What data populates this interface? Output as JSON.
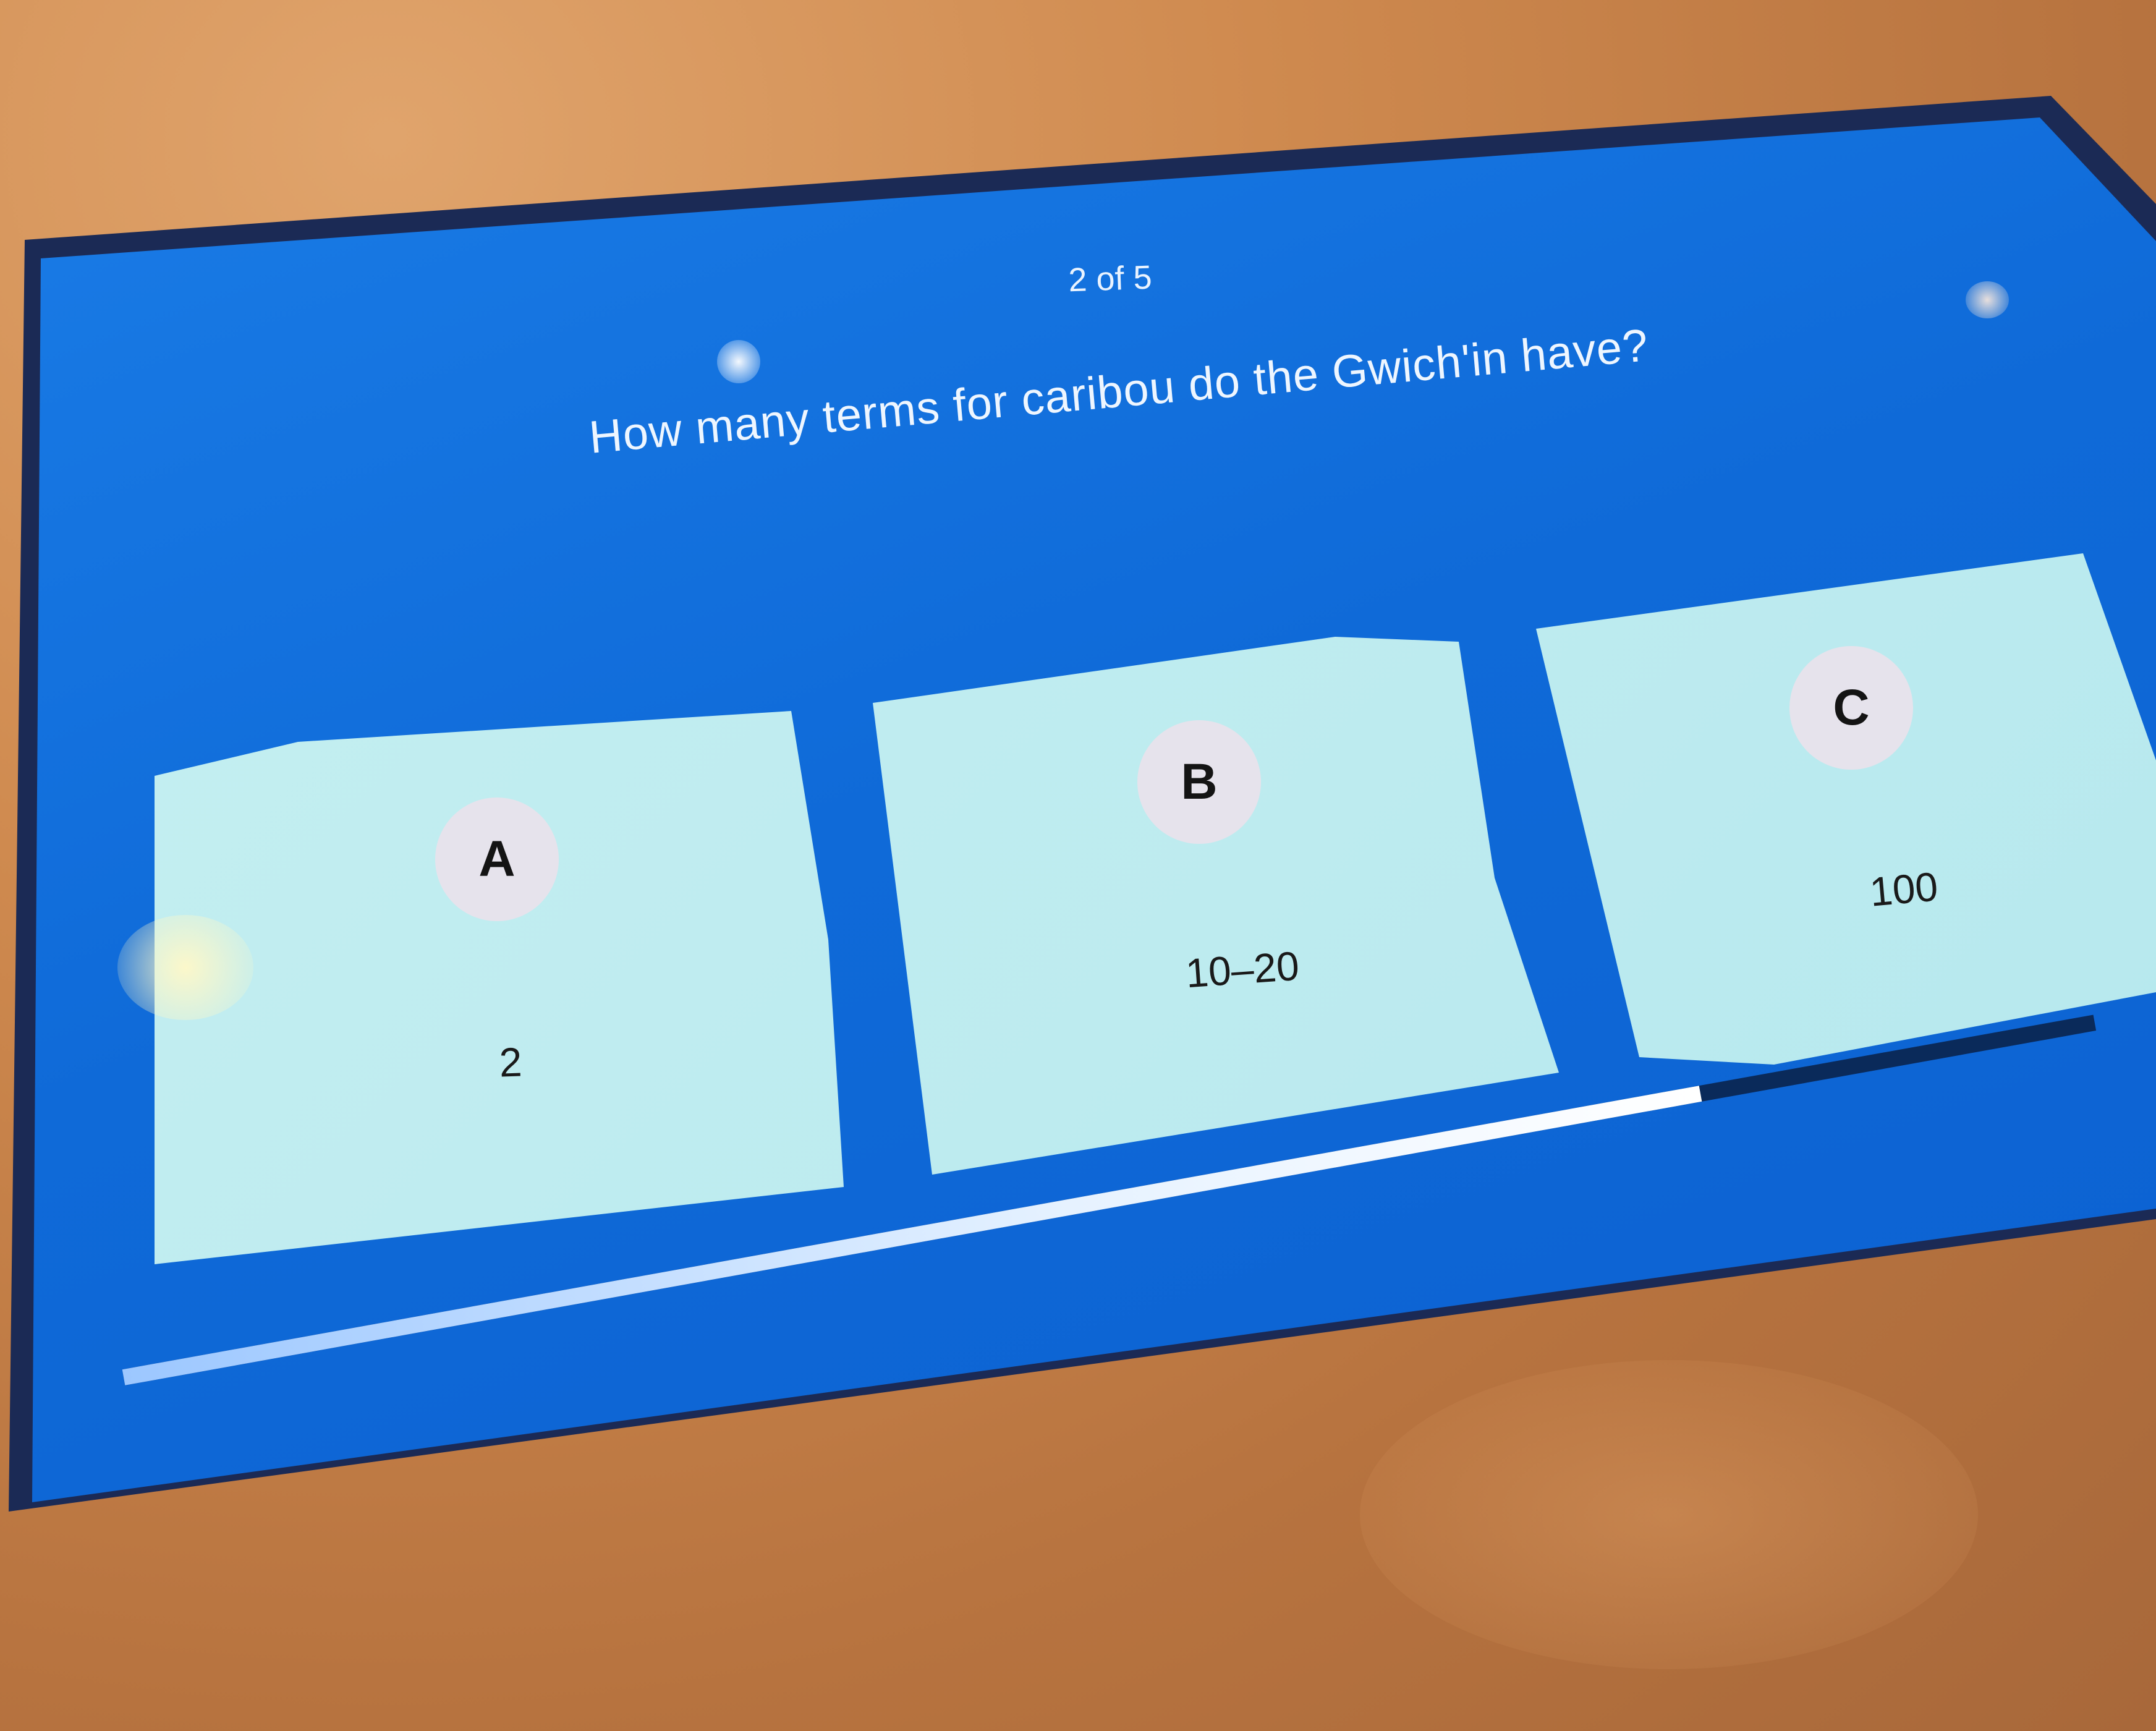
{
  "quiz": {
    "progress_text": "2 of 5",
    "question": "How many terms for caribou do the Gwich'in have?",
    "options": [
      {
        "letter": "A",
        "answer": "2"
      },
      {
        "letter": "B",
        "answer": "10–20"
      },
      {
        "letter": "C",
        "answer": "100"
      }
    ],
    "timer_fraction": 0.8
  },
  "colors": {
    "screen_background": "#0f6ad8",
    "card_background": "#c6f0f2",
    "badge_background": "#e6e3ec",
    "text_light": "#eef6ff",
    "text_dark": "#1a1a1a"
  }
}
